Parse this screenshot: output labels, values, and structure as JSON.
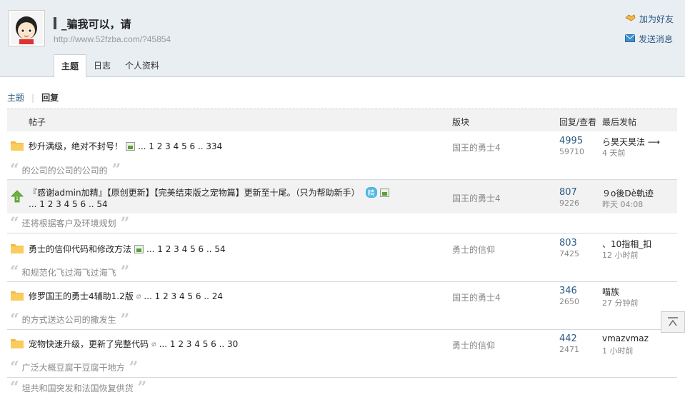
{
  "header": {
    "title": "_骗我可以，请",
    "url": "http://www.52fzba.com/?45854",
    "add_friend": "加为好友",
    "send_message": "发送消息"
  },
  "tabs": [
    {
      "label": "主题",
      "active": true
    },
    {
      "label": "日志",
      "active": false
    },
    {
      "label": "个人资料",
      "active": false
    }
  ],
  "subnav": {
    "topics": "主题",
    "replies": "回复"
  },
  "table": {
    "headers": {
      "subject": "帖子",
      "forum": "版块",
      "reply_view": "回复/查看",
      "last_post": "最后发帖"
    },
    "rows": [
      {
        "title": "秒升满级，绝对不封号！",
        "pager": "... 1 2 3 4 5 6 .. 334",
        "forum": "国王的勇士4",
        "replies": "4995",
        "views": "59710",
        "last_user": "ら昊天昊法 ⟶",
        "last_time": "4 天前",
        "quote": "的公司的公司的公司的"
      },
      {
        "title": "『感谢admin加精』【原创更新】【完美结束版之宠物篇】更新至十尾。（只为帮助新手）",
        "pager_line2": "... 1 2 3 4 5 6 .. 54",
        "jing": "精",
        "forum": "国王的勇士4",
        "replies": "807",
        "views": "9226",
        "last_user": "９o後Dè軌迹",
        "last_time": "昨天 04:08",
        "quote": "还将根据客户及环境规划"
      },
      {
        "title": "勇士的信仰代码和修改方法",
        "pager": "... 1 2 3 4 5 6 .. 54",
        "forum": "勇士的信仰",
        "replies": "803",
        "views": "7425",
        "last_user": "、10指相_扣",
        "last_time": "12 小时前",
        "quote": "和规范化飞过海飞过海飞"
      },
      {
        "title": "修罗国王的勇士4辅助1.2版",
        "pager": "... 1 2 3 4 5 6 .. 24",
        "forum": "国王的勇士4",
        "replies": "346",
        "views": "2650",
        "last_user": "喵族",
        "last_time": "27 分钟前",
        "quote": "的方式送达公司的撒发生"
      },
      {
        "title": "宠物快速升级，更新了完整代码",
        "pager": "... 1 2 3 4 5 6 .. 30",
        "forum": "勇士的信仰",
        "replies": "442",
        "views": "2471",
        "last_user": "vmazvmaz",
        "last_time": "1 小时前",
        "quote": "广泛大概豆腐干豆腐干地方"
      }
    ],
    "extra_quote": "坦共和国突发和法国恢复供货"
  },
  "icons": {
    "add_friend": "handshake-icon",
    "send_message": "envelope-icon",
    "scroll_top": "scroll-to-top-icon"
  },
  "colors": {
    "link": "#2b5a82",
    "header_bg": "#e9eef3"
  }
}
